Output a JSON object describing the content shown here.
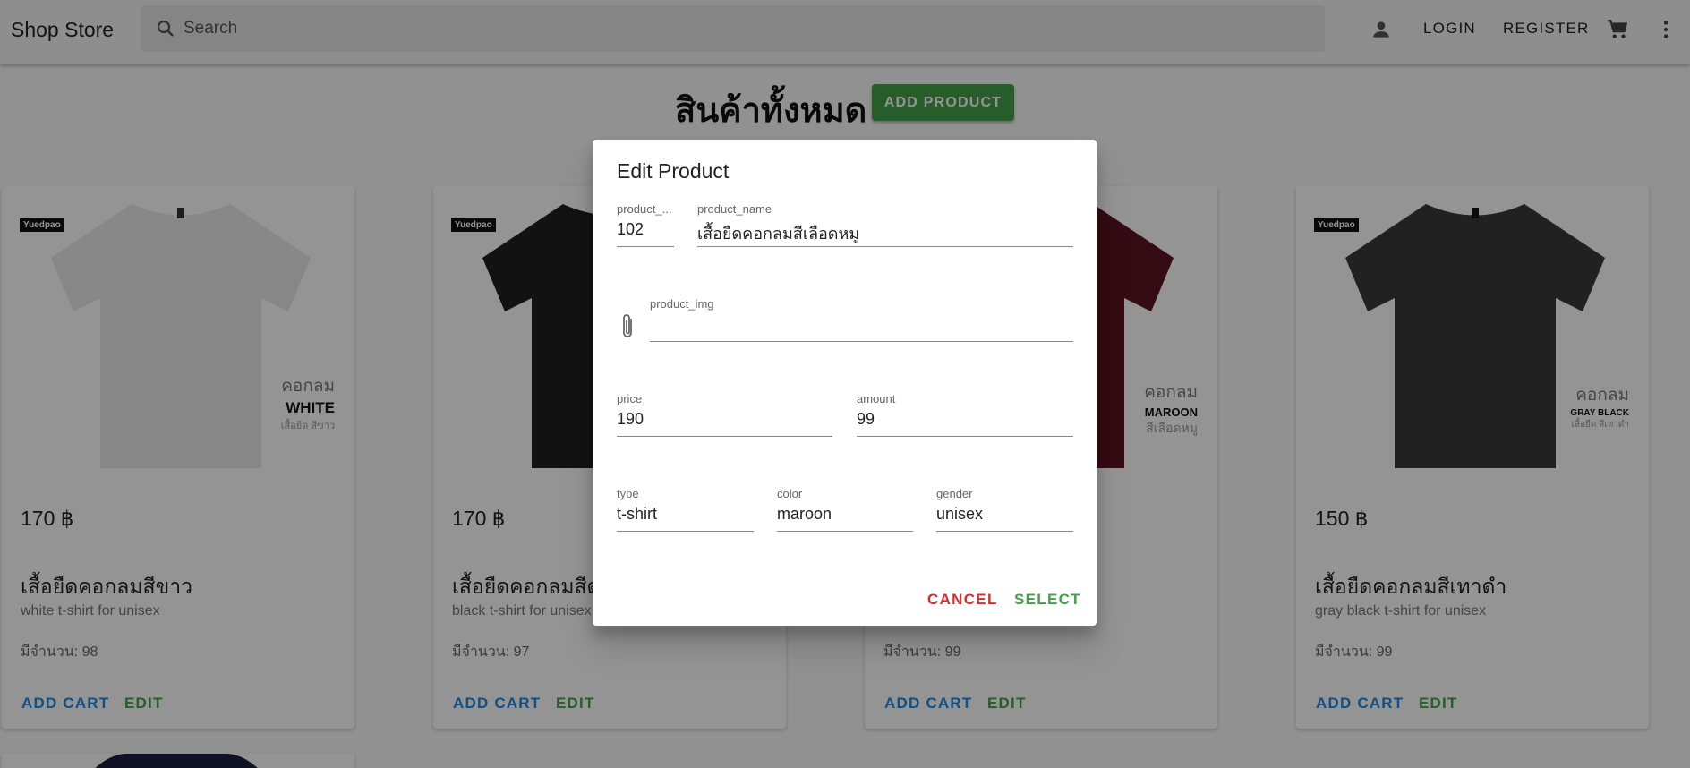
{
  "appbar": {
    "brand": "Shop Store",
    "search_placeholder": "Search",
    "login_label": "LOGIN",
    "register_label": "REGISTER"
  },
  "page": {
    "title": "สินค้าทั้งหมด",
    "add_product_label": "ADD PRODUCT"
  },
  "products": [
    {
      "brand_tag": "Yuedpao",
      "shirt_color": "#e8e8e8",
      "label_l1": "คอกลม",
      "label_l2": "WHITE",
      "label_l3": "เสื้อยืด สีขาว",
      "price": "170 ฿",
      "name": "เสื้อยืดคอกลมสีขาว",
      "desc": "white t-shirt for unisex",
      "stock": "มีจำนวน: 98"
    },
    {
      "brand_tag": "Yuedpao",
      "shirt_color": "#1f1f1f",
      "label_l1": "",
      "label_l2": "",
      "label_l3": "",
      "price": "170 ฿",
      "name": "เสื้อยืดคอกลมสีดำ",
      "desc": "black t-shirt for unisex",
      "stock": "มีจำนวน: 97"
    },
    {
      "brand_tag": "",
      "shirt_color": "#5a1420",
      "label_l1": "คอกลม",
      "label_l2": "MAROON",
      "label_l3": "สีเลือดหมู",
      "price": "",
      "name": "",
      "desc": "",
      "stock": "มีจำนวน: 99"
    },
    {
      "brand_tag": "Yuedpao",
      "shirt_color": "#3a3a3a",
      "label_l1": "คอกลม",
      "label_l2": "GRAY BLACK",
      "label_l3": "เสื้อยืด สีเทาดำ",
      "price": "150 ฿",
      "name": "เสื้อยืดคอกลมสีเทาดำ",
      "desc": "gray black t-shirt for unisex",
      "stock": "มีจำนวน: 99"
    }
  ],
  "card_actions": {
    "add_cart_label": "ADD CART",
    "edit_label": "EDIT"
  },
  "dialog": {
    "title": "Edit Product",
    "product_id": {
      "label": "product_...",
      "value": "102"
    },
    "product_name": {
      "label": "product_name",
      "value": "เสื้อยืดคอกลมสีเลือดหมู"
    },
    "product_img": {
      "label": "product_img",
      "value": ""
    },
    "price": {
      "label": "price",
      "value": "190"
    },
    "amount": {
      "label": "amount",
      "value": "99"
    },
    "type": {
      "label": "type",
      "value": "t-shirt"
    },
    "color": {
      "label": "color",
      "value": "maroon"
    },
    "gender": {
      "label": "gender",
      "value": "unisex"
    },
    "cancel_label": "CANCEL",
    "select_label": "SELECT"
  },
  "colors": {
    "primary_blue": "#1e88e5",
    "success_green": "#43a047",
    "danger_red": "#d32f2f"
  }
}
